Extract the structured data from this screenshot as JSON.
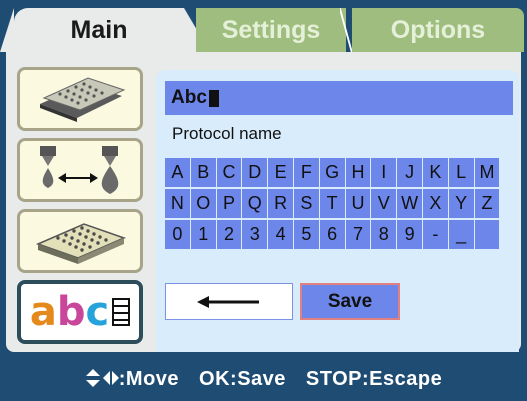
{
  "tabs": [
    {
      "label": "Main",
      "active": true
    },
    {
      "label": "Settings",
      "active": false
    },
    {
      "label": "Options",
      "active": false
    }
  ],
  "side_buttons": [
    {
      "icon": "microplate-stack-icon"
    },
    {
      "icon": "dispense-nozzle-icon"
    },
    {
      "icon": "microplate-icon"
    },
    {
      "icon": "abc-name-icon",
      "text": "abc",
      "selected": true
    }
  ],
  "name_field": {
    "value": "Abc",
    "label": "Protocol name"
  },
  "keyboard": {
    "rows": [
      [
        "A",
        "B",
        "C",
        "D",
        "E",
        "F",
        "G",
        "H",
        "I",
        "J",
        "K",
        "L",
        "M"
      ],
      [
        "N",
        "O",
        "P",
        "Q",
        "R",
        "S",
        "T",
        "U",
        "V",
        "W",
        "X",
        "Y",
        "Z"
      ],
      [
        "0",
        "1",
        "2",
        "3",
        "4",
        "5",
        "6",
        "7",
        "8",
        "9",
        "-",
        "_",
        " "
      ]
    ]
  },
  "actions": {
    "save_label": "Save",
    "backspace_icon": "left-arrow-icon"
  },
  "footer": {
    "move_hint": ":Move",
    "ok_hint": "OK:Save",
    "stop_hint": "STOP:Escape"
  },
  "colors": {
    "background": "#1f4c73",
    "key": "#6c86ea",
    "inner_panel": "#d8ecfb",
    "inactive_tab": "#9fbd7e"
  }
}
